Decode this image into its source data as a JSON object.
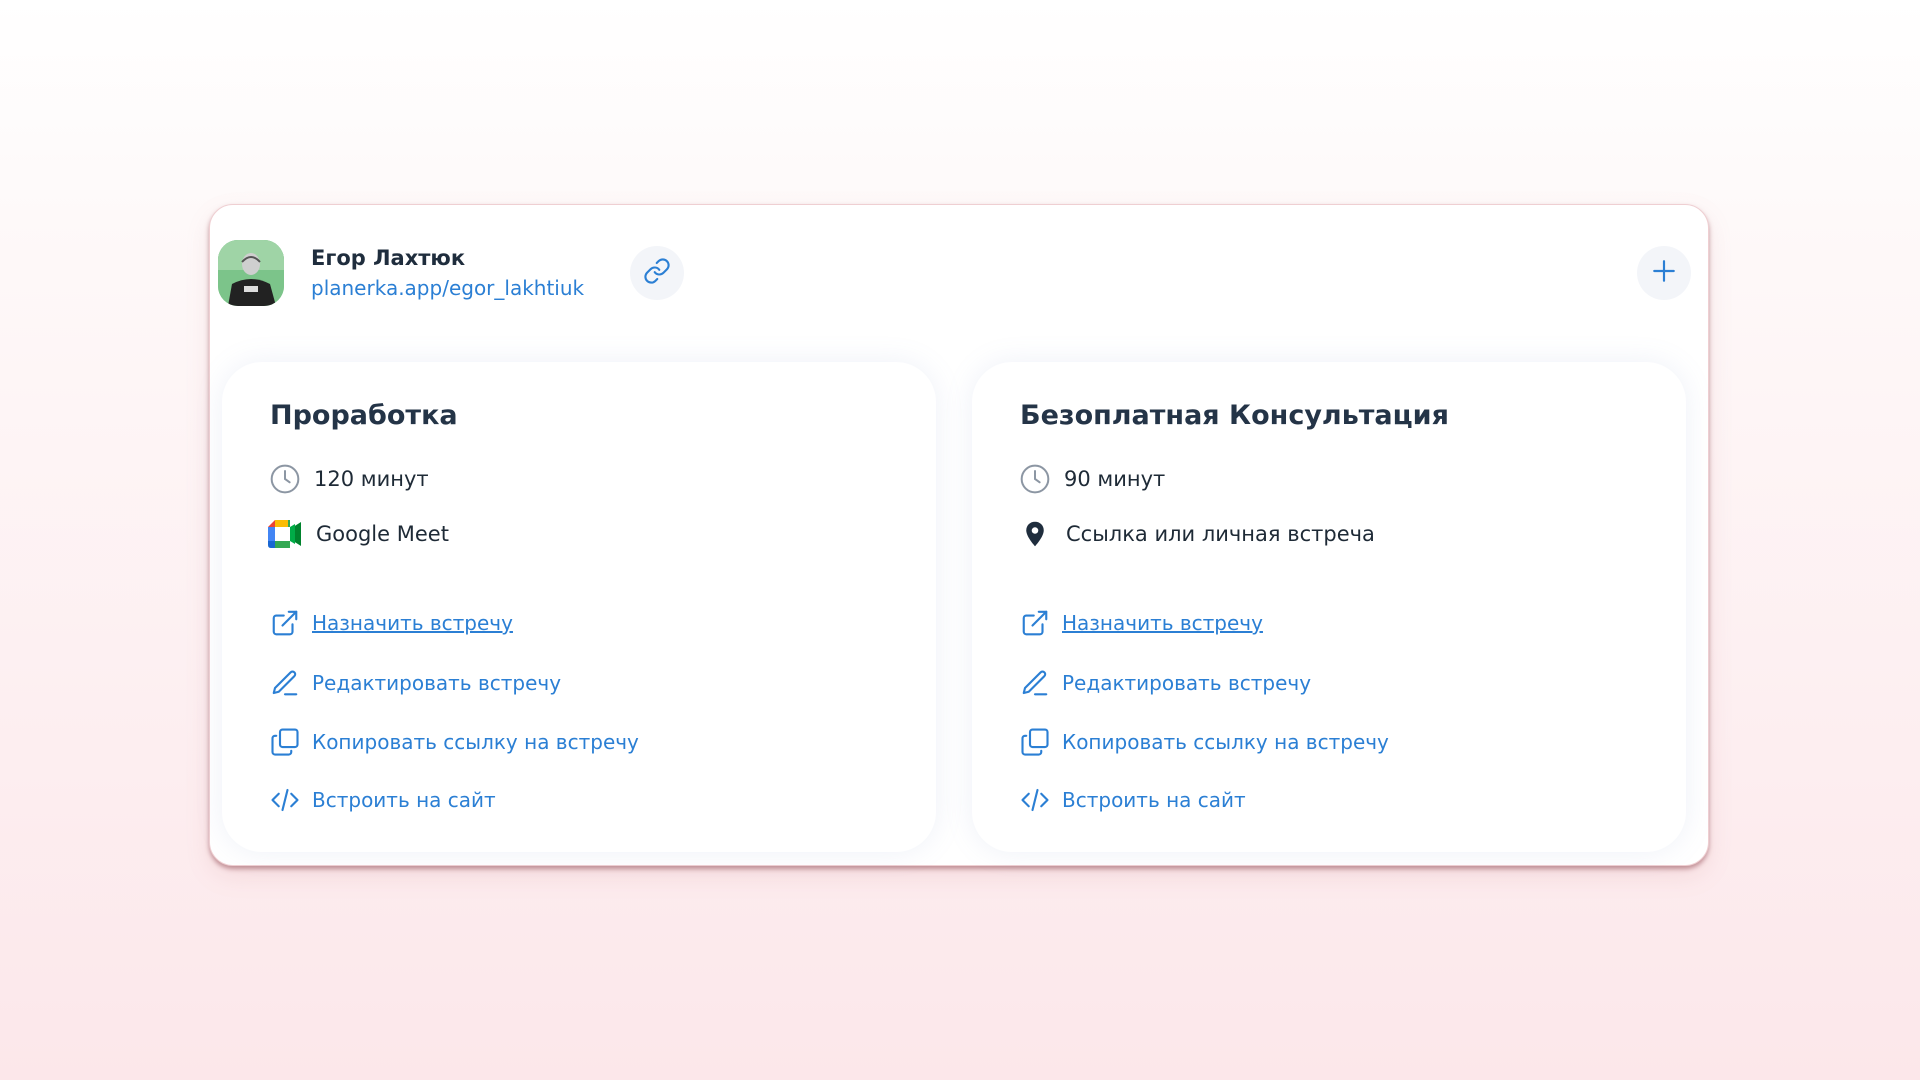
{
  "profile": {
    "name": "Егор Лахтюк",
    "link": "planerka.app/egor_lakhtiuk",
    "avatar_icon": "avatar-photo"
  },
  "header_buttons": {
    "copy_link_icon": "link-icon",
    "add_icon": "plus-icon"
  },
  "colors": {
    "accent": "#2b7fd4",
    "text_dark": "#1f2d3d",
    "icon_gray": "#8c96a3",
    "button_bg": "#f3f5f9"
  },
  "events": [
    {
      "title": "Проработка",
      "duration": "120 минут",
      "duration_icon": "clock-icon",
      "location": "Google Meet",
      "location_icon": "google-meet-icon",
      "actions": {
        "schedule": "Назначить встречу",
        "edit": "Редактировать встречу",
        "copy": "Копировать ссылку на встречу",
        "embed": "Встроить на сайт"
      }
    },
    {
      "title": "Безоплатная Консультация",
      "duration": "90 минут",
      "duration_icon": "clock-icon",
      "location": "Ссылка или личная встреча",
      "location_icon": "location-pin-icon",
      "actions": {
        "schedule": "Назначить встречу",
        "edit": "Редактировать встречу",
        "copy": "Копировать ссылку на встречу",
        "embed": "Встроить на сайт"
      }
    }
  ]
}
